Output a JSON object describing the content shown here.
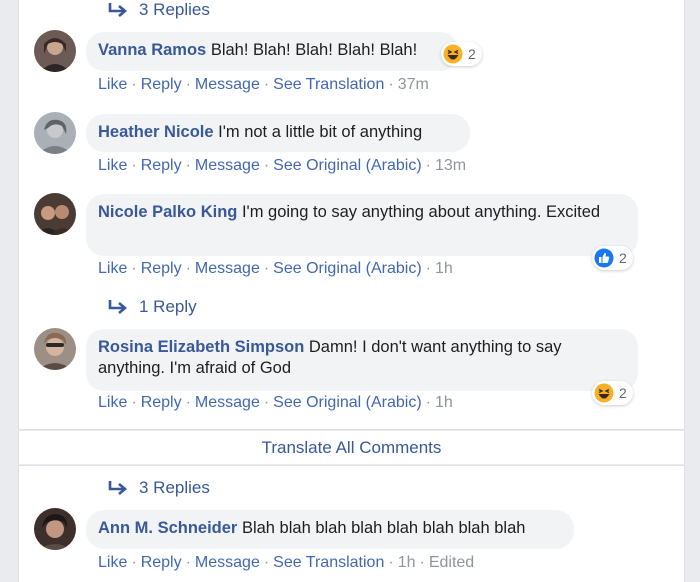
{
  "thread": {
    "reply_counts": [
      "3 Replies",
      "1 Reply",
      "3 Replies"
    ],
    "translate_all": "Translate All Comments"
  },
  "actions": {
    "like": "Like",
    "reply": "Reply",
    "message": "Message",
    "see_translation": "See Translation",
    "see_original": "See Original (Arabic)",
    "sep": "·"
  },
  "comments": [
    {
      "author": "Vanna Ramos",
      "text": "Blah! Blah! Blah! Blah! Blah!",
      "translate_label": "See Translation",
      "time": "37m",
      "reaction": {
        "type": "haha",
        "count": "2"
      }
    },
    {
      "author": "Heather Nicole",
      "text": "I'm not a little bit of anything",
      "translate_label": "See Original (Arabic)",
      "time": "13m"
    },
    {
      "author": "Nicole Palko King",
      "text": "I'm going to say anything about anything. Excited",
      "translate_label": "See Original (Arabic)",
      "time": "1h",
      "reaction": {
        "type": "like",
        "count": "2"
      }
    },
    {
      "author": "Rosina Elizabeth Simpson",
      "text": "Damn! I don't want anything to say anything. I'm afraid of God",
      "translate_label": "See Original (Arabic)",
      "time": "1h",
      "reaction": {
        "type": "haha",
        "count": "2"
      }
    },
    {
      "author": "Ann M. Schneider",
      "text": "Blah blah blah blah blah blah blah blah",
      "translate_label": "See Translation",
      "time": "1h",
      "edited": "Edited"
    }
  ],
  "colors": {
    "link": "#385898",
    "action_link": "#4267b2",
    "bubble": "#f2f3f5",
    "meta": "#90949c",
    "like_blue": "#1877f2",
    "haha_yellow": "#f7b125"
  },
  "icons": [
    "reply-arrow-icon",
    "haha-emoji-icon",
    "like-thumb-icon"
  ]
}
